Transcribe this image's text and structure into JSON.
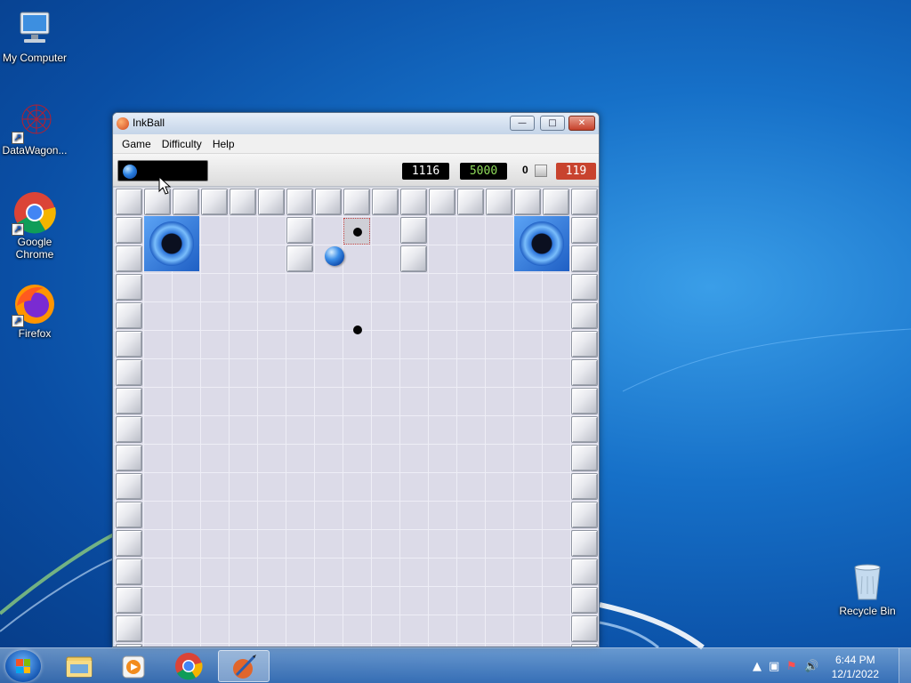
{
  "desktop": {
    "icons": [
      {
        "label": "My Computer",
        "icon": "computer-icon"
      },
      {
        "label": "DataWagon...",
        "icon": "datawagon-icon"
      },
      {
        "label": "Google Chrome",
        "icon": "chrome-icon"
      },
      {
        "label": "Firefox",
        "icon": "firefox-icon"
      },
      {
        "label": "Recycle Bin",
        "icon": "recycle-bin-icon"
      }
    ]
  },
  "window": {
    "title": "InkBall",
    "minimize": "—",
    "maximize": "□",
    "close": "✕",
    "menu": [
      "Game",
      "Difficulty",
      "Help"
    ]
  },
  "scoreboard": {
    "score": "1116",
    "target": "5000",
    "balls_captured": "0",
    "time": "119"
  },
  "taskbar": {
    "apps": [
      "file-explorer-icon",
      "media-player-icon",
      "chrome-icon",
      "inkball-icon"
    ],
    "clock_time": "6:44 PM",
    "clock_date": "12/1/2022"
  },
  "colors": {
    "hole": "#2f7ad9",
    "ball": "#2a7fe0",
    "time_box": "#c8432e",
    "target_text": "#8fdc5a"
  }
}
